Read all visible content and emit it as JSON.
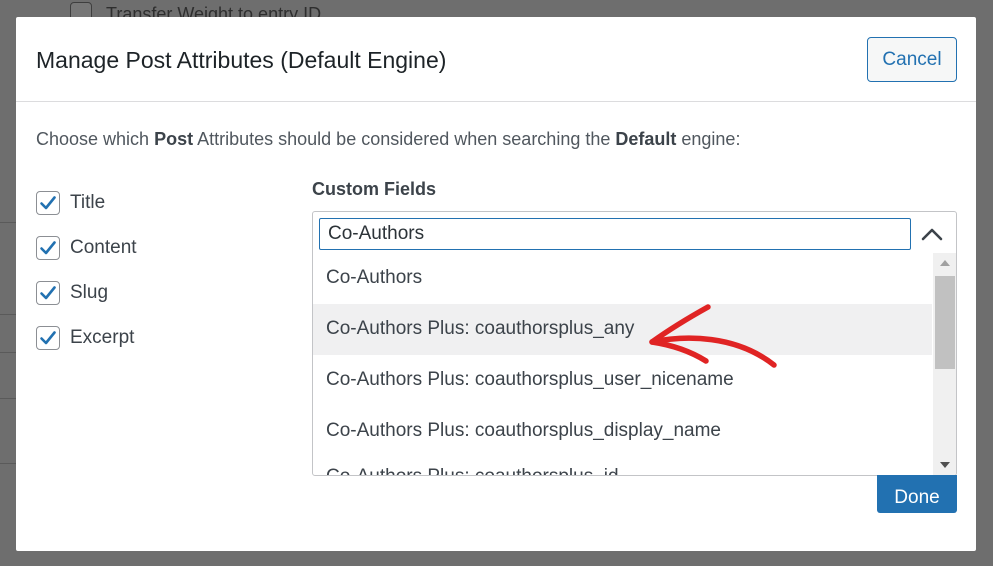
{
  "background": {
    "checkbox_text": "Transfer Weight to entry ID"
  },
  "modal": {
    "title": "Manage Post Attributes (Default Engine)",
    "cancel_label": "Cancel",
    "done_label": "Done",
    "intro": {
      "part1": "Choose which ",
      "bold1": "Post",
      "part2": " Attributes should be considered when searching the ",
      "bold2": "Default",
      "part3": " engine:"
    },
    "attributes": [
      {
        "label": "Title",
        "checked": true
      },
      {
        "label": "Content",
        "checked": true
      },
      {
        "label": "Slug",
        "checked": true
      },
      {
        "label": "Excerpt",
        "checked": true
      }
    ],
    "custom_fields": {
      "label": "Custom Fields",
      "search_value": "Co-Authors",
      "options": [
        "Co-Authors",
        "Co-Authors Plus: coauthorsplus_any",
        "Co-Authors Plus: coauthorsplus_user_nicename",
        "Co-Authors Plus: coauthorsplus_display_name",
        "Co-Authors Plus: coauthorsplus_id"
      ],
      "highlighted_index": 1
    }
  },
  "colors": {
    "accent": "#2271b1",
    "annotation": "#e02424",
    "checkbox_check": "#2271b1"
  }
}
